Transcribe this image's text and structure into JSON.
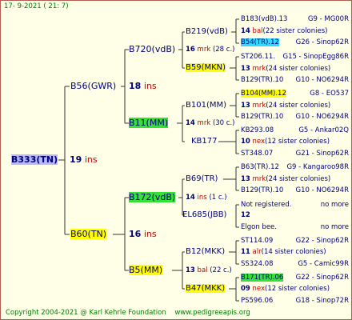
{
  "header": {
    "date": "17-  9-2021  (  21:  7)"
  },
  "footer": {
    "copyright": "Copyright 2004-2021 @ Karl Kehrle Foundation",
    "site": "www.pedigreeapis.org"
  },
  "root": {
    "name": "B333(TN)",
    "ins": "19",
    "ins_label": "ins"
  },
  "gen1": [
    {
      "name": "B56(GWR)",
      "ins": "18",
      "ins_label": "ins"
    },
    {
      "name": "B60(TN)",
      "ins": "16",
      "ins_label": "ins"
    }
  ],
  "gen2": [
    {
      "name": "B720(vdB)",
      "num": "16",
      "info": "mrk",
      "info_extra": "(28 c.)"
    },
    {
      "name": "B11(MM)",
      "num": "14",
      "info": "mrk",
      "info_extra": "(30 c.)"
    },
    {
      "name": "B172(vdB)",
      "num": "14",
      "info": "ins",
      "info_extra": "(1 c.)"
    },
    {
      "name": "B5(MM)",
      "num": "13",
      "info": "bal",
      "info_extra": "(22 c.)"
    }
  ],
  "gen3": [
    {
      "name": "B219(vdB)"
    },
    {
      "name": "B59(MKN)"
    },
    {
      "name": "B101(MM)"
    },
    {
      "name": "KB177"
    },
    {
      "name": "B69(TR)"
    },
    {
      "name": "EL685(JBB)"
    },
    {
      "name": "B12(MKK)"
    },
    {
      "name": "B47(MKK)"
    }
  ],
  "gen3_mid": [
    {
      "num": "14",
      "info": "bal",
      "extra": "(22 sister colonies)"
    },
    {
      "num": "13",
      "info": "mrk",
      "extra": "(24 sister colonies)"
    },
    {
      "num": "13",
      "info": "mrk",
      "extra": "(24 sister colonies)"
    },
    {
      "num": "10",
      "info": "nex",
      "extra": "(12 sister colonies)"
    },
    {
      "num": "13",
      "info": "mrk",
      "extra": "(24 sister colonies)"
    },
    {
      "num": "12",
      "info": "",
      "extra": ""
    },
    {
      "num": "11",
      "info": "alr",
      "extra": "(14 sister colonies)"
    },
    {
      "num": "09",
      "info": "nex",
      "extra": "(12 sister colonies)"
    }
  ],
  "gen4": [
    {
      "name": "B183(vdB).13",
      "line": "G9 - MG00R"
    },
    {
      "name": "B54(TR).12",
      "line": "G26 - Sinop62R"
    },
    {
      "name": "ST206.11.",
      "line": "G15 - SinopEgg86R"
    },
    {
      "name": "B129(TR).10",
      "line": "G10 - NO6294R"
    },
    {
      "name": "B104(MM).12",
      "line": "G8 - EO537"
    },
    {
      "name": "B129(TR).10",
      "line": "G10 - NO6294R"
    },
    {
      "name": "KB293.08",
      "line": "G5 - Ankar02Q"
    },
    {
      "name": "ST348.07",
      "line": "G21 - Sinop62R"
    },
    {
      "name": "B63(TR).12",
      "line": "G9 - Kangaroo98R"
    },
    {
      "name": "B129(TR).10",
      "line": "G10 - NO6294R"
    },
    {
      "name": "Not registered.",
      "line": "no more"
    },
    {
      "name": "Elgon bee.",
      "line": "no more"
    },
    {
      "name": "ST114.09",
      "line": "G22 - Sinop62R"
    },
    {
      "name": "SS324.08",
      "line": "G5 - Camic99R"
    },
    {
      "name": "B171(TR).06",
      "line": "G22 - Sinop62R"
    },
    {
      "name": "PS596.06",
      "line": "G18 - Sinop72R"
    }
  ]
}
